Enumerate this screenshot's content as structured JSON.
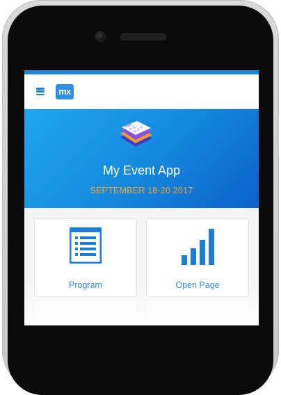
{
  "app": {
    "logo_text": "mx",
    "menu_icon": "hamburger-menu-icon"
  },
  "hero": {
    "title": "My Event App",
    "date": "SEPTEMBER 18-20 2017",
    "icon": "layered-app-stack-icon"
  },
  "tiles": [
    {
      "label": "Program",
      "icon": "list-document-icon"
    },
    {
      "label": "Open Page",
      "icon": "bar-chart-icon"
    }
  ],
  "colors": {
    "accent": "#1e88d8",
    "hero_start": "#1ea7ef",
    "hero_end": "#0b62c8",
    "date": "#f3a533",
    "tile_label": "#2d8ad8"
  }
}
